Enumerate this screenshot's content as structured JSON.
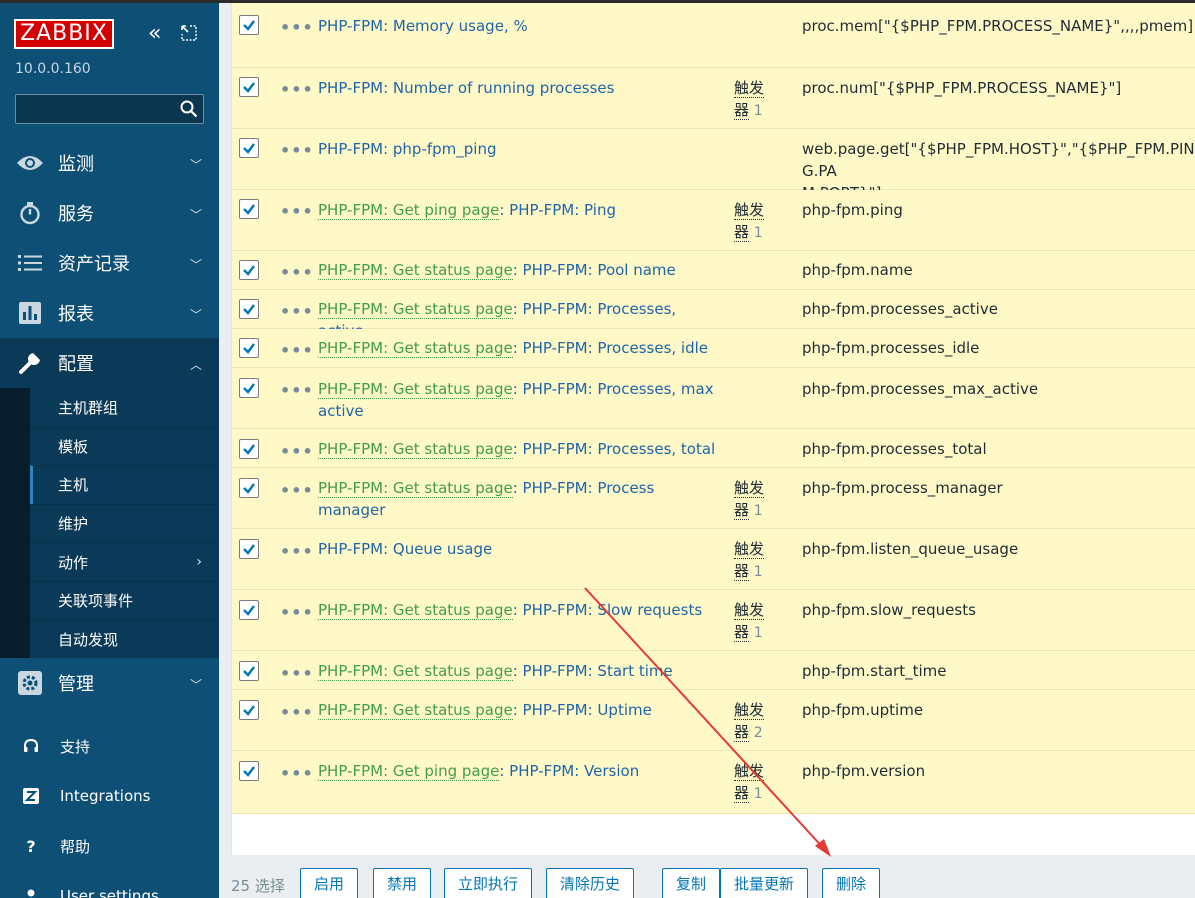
{
  "sidebar": {
    "logo": "ZABBIX",
    "version": "10.0.0.160",
    "search": {
      "placeholder": "",
      "value": ""
    },
    "nav": [
      {
        "label": "监测",
        "icon": "eye-icon"
      },
      {
        "label": "服务",
        "icon": "stopwatch-icon"
      },
      {
        "label": "资产记录",
        "icon": "list-icon"
      },
      {
        "label": "报表",
        "icon": "bar-chart-icon"
      },
      {
        "label": "配置",
        "icon": "wrench-icon"
      }
    ],
    "config_submenu": [
      {
        "label": "主机群组"
      },
      {
        "label": "模板"
      },
      {
        "label": "主机"
      },
      {
        "label": "维护"
      },
      {
        "label": "动作"
      },
      {
        "label": "关联项事件"
      },
      {
        "label": "自动发现"
      }
    ],
    "admin": {
      "label": "管理",
      "icon": "gear-icon"
    },
    "bottom": [
      {
        "label": "支持",
        "icon": "headset-icon"
      },
      {
        "label": "Integrations",
        "icon": "zabbix-z-icon"
      },
      {
        "label": "帮助",
        "icon": "question-icon"
      },
      {
        "label": "User settings",
        "icon": "user-icon"
      }
    ]
  },
  "items": [
    {
      "prefix": "",
      "name": "PHP-FPM: Memory usage, %",
      "trigger_label": "",
      "trigger_count": "",
      "key": "proc.mem[\"{$PHP_FPM.PROCESS_NAME}\",,,,pmem]"
    },
    {
      "prefix": "",
      "name": "PHP-FPM: Number of running processes",
      "trigger_label": "触发器",
      "trigger_count": "1",
      "key": "proc.num[\"{$PHP_FPM.PROCESS_NAME}\"]"
    },
    {
      "prefix": "",
      "name": "PHP-FPM: php-fpm_ping",
      "trigger_label": "",
      "trigger_count": "",
      "key": "web.page.get[\"{$PHP_FPM.HOST}\",\"{$PHP_FPM.PING.PA\nM.PORT}\"]"
    },
    {
      "prefix": "PHP-FPM: Get ping page",
      "name": "PHP-FPM: Ping",
      "trigger_label": "触发器",
      "trigger_count": "1",
      "key": "php-fpm.ping"
    },
    {
      "prefix": "PHP-FPM: Get status page",
      "name": "PHP-FPM: Pool name",
      "trigger_label": "",
      "trigger_count": "",
      "key": "php-fpm.name"
    },
    {
      "prefix": "PHP-FPM: Get status page",
      "name": "PHP-FPM: Processes, active",
      "trigger_label": "",
      "trigger_count": "",
      "key": "php-fpm.processes_active"
    },
    {
      "prefix": "PHP-FPM: Get status page",
      "name": "PHP-FPM: Processes, idle",
      "trigger_label": "",
      "trigger_count": "",
      "key": "php-fpm.processes_idle"
    },
    {
      "prefix": "PHP-FPM: Get status page",
      "name": "PHP-FPM: Processes, max active",
      "trigger_label": "",
      "trigger_count": "",
      "key": "php-fpm.processes_max_active"
    },
    {
      "prefix": "PHP-FPM: Get status page",
      "name": "PHP-FPM: Processes, total",
      "trigger_label": "",
      "trigger_count": "",
      "key": "php-fpm.processes_total"
    },
    {
      "prefix": "PHP-FPM: Get status page",
      "name": "PHP-FPM: Process manager",
      "trigger_label": "触发器",
      "trigger_count": "1",
      "key": "php-fpm.process_manager"
    },
    {
      "prefix": "",
      "name": "PHP-FPM: Queue usage",
      "trigger_label": "触发器",
      "trigger_count": "1",
      "key": "php-fpm.listen_queue_usage"
    },
    {
      "prefix": "PHP-FPM: Get status page",
      "name": "PHP-FPM: Slow requests",
      "trigger_label": "触发器",
      "trigger_count": "1",
      "key": "php-fpm.slow_requests"
    },
    {
      "prefix": "PHP-FPM: Get status page",
      "name": "PHP-FPM: Start time",
      "trigger_label": "",
      "trigger_count": "",
      "key": "php-fpm.start_time"
    },
    {
      "prefix": "PHP-FPM: Get status page",
      "name": "PHP-FPM: Uptime",
      "trigger_label": "触发器",
      "trigger_count": "2",
      "key": "php-fpm.uptime"
    },
    {
      "prefix": "PHP-FPM: Get ping page",
      "name": "PHP-FPM: Version",
      "trigger_label": "触发器",
      "trigger_count": "1",
      "key": "php-fpm.version"
    }
  ],
  "footer": {
    "selected_count": "25 选择",
    "buttons": [
      "启用",
      "禁用",
      "立即执行",
      "清除历史",
      "复制",
      "批量更新",
      "删除"
    ]
  },
  "colors": {
    "sidebar_bg": "#0e4f76",
    "row_highlight": "#fff9c8",
    "link": "#1f65a8",
    "prefix_link": "#429e47",
    "annotation_arrow": "#e53935"
  }
}
